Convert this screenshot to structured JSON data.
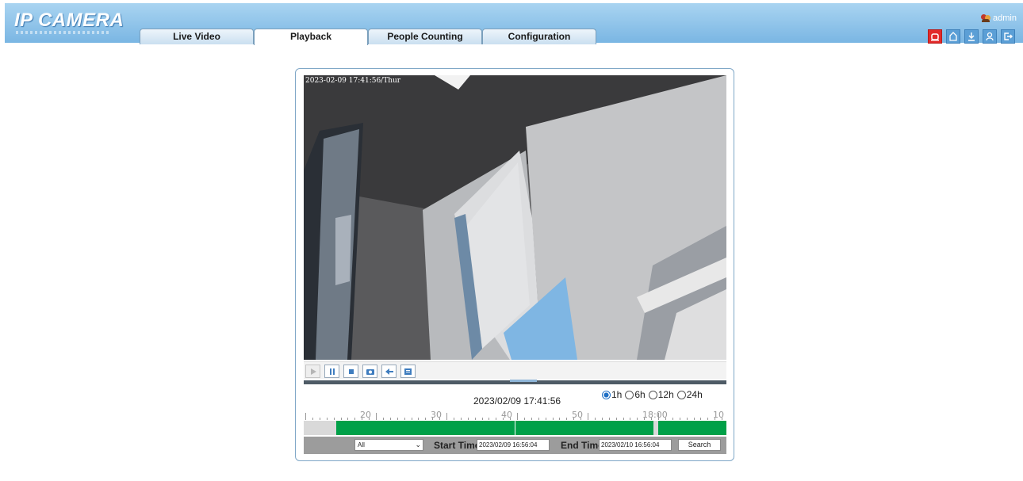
{
  "app": {
    "logo": "IP CAMERA"
  },
  "tabs": [
    {
      "label": "Live Video"
    },
    {
      "label": "Playback",
      "active": true
    },
    {
      "label": "People Counting"
    },
    {
      "label": "Configuration"
    }
  ],
  "user": {
    "name": "admin",
    "icon": "user-group-icon"
  },
  "toolbar": {
    "icons": [
      "alarm-icon",
      "home-icon",
      "download-icon",
      "user-switch-icon",
      "logout-icon"
    ]
  },
  "player": {
    "osd_timestamp": "2023-02-09 17:41:56/Thur",
    "controls": [
      "play-icon",
      "pause-icon",
      "stop-icon",
      "snapshot-icon",
      "rewind-icon",
      "clip-icon"
    ],
    "current_time": "2023/02/09 17:41:56",
    "range_options": [
      {
        "label": "1h",
        "checked": true
      },
      {
        "label": "6h",
        "checked": false
      },
      {
        "label": "12h",
        "checked": false
      },
      {
        "label": "24h",
        "checked": false
      }
    ],
    "ruler_labels": [
      "20",
      "30",
      "40",
      "50",
      "18:00",
      "10"
    ]
  },
  "search": {
    "type_value": "All",
    "start_label": "Start Time",
    "start_value": "2023/02/09 16:56:04",
    "end_label": "End Time",
    "end_value": "2023/02/10 16:56:04",
    "button_label": "Search"
  },
  "colors": {
    "header_top": "#a9d4f1",
    "header_bottom": "#7ab6e3",
    "record_green": "#00a048",
    "alarm_red": "#e22a2a"
  }
}
